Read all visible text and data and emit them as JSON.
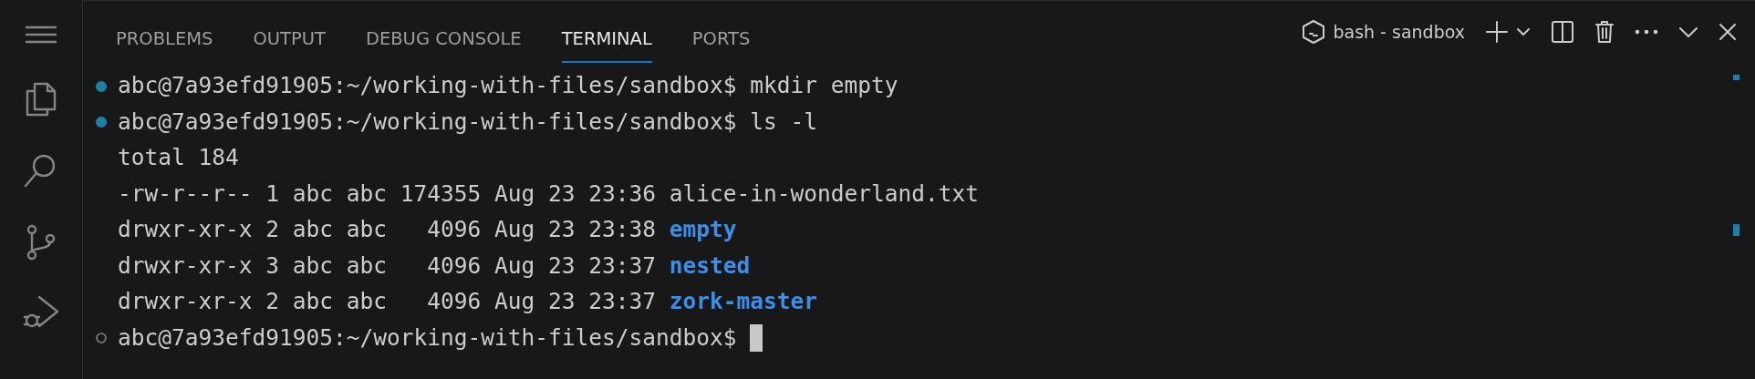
{
  "activity_bar": {
    "items": [
      {
        "kind": "menu"
      },
      {
        "kind": "files"
      },
      {
        "kind": "search"
      },
      {
        "kind": "source-control"
      },
      {
        "kind": "run-debug"
      }
    ]
  },
  "panel": {
    "tabs": [
      {
        "label": "PROBLEMS",
        "selected": false
      },
      {
        "label": "OUTPUT",
        "selected": false
      },
      {
        "label": "DEBUG CONSOLE",
        "selected": false
      },
      {
        "label": "TERMINAL",
        "selected": true
      },
      {
        "label": "PORTS",
        "selected": false
      }
    ],
    "terminal_name": "bash - sandbox"
  },
  "terminal": {
    "lines": [
      {
        "kind": "prompt",
        "completed": true,
        "prompt": "abc@7a93efd91905:~/working-with-files/sandbox$",
        "command": "mkdir empty",
        "cursor": false
      },
      {
        "kind": "prompt",
        "completed": true,
        "prompt": "abc@7a93efd91905:~/working-with-files/sandbox$",
        "command": "ls -l",
        "cursor": false
      },
      {
        "kind": "output",
        "text": "total 184"
      },
      {
        "kind": "listing",
        "text": "-rw-r--r-- 1 abc abc 174355 Aug 23 23:36",
        "name": "alice-in-wonderland.txt",
        "directory": false
      },
      {
        "kind": "listing",
        "text": "drwxr-xr-x 2 abc abc   4096 Aug 23 23:38",
        "name": "empty",
        "directory": true
      },
      {
        "kind": "listing",
        "text": "drwxr-xr-x 3 abc abc   4096 Aug 23 23:37",
        "name": "nested",
        "directory": true
      },
      {
        "kind": "listing",
        "text": "drwxr-xr-x 2 abc abc   4096 Aug 23 23:37",
        "name": "zork-master",
        "directory": true
      },
      {
        "kind": "prompt",
        "completed": false,
        "prompt": "abc@7a93efd91905:~/working-with-files/sandbox$",
        "cursor": true
      }
    ]
  }
}
